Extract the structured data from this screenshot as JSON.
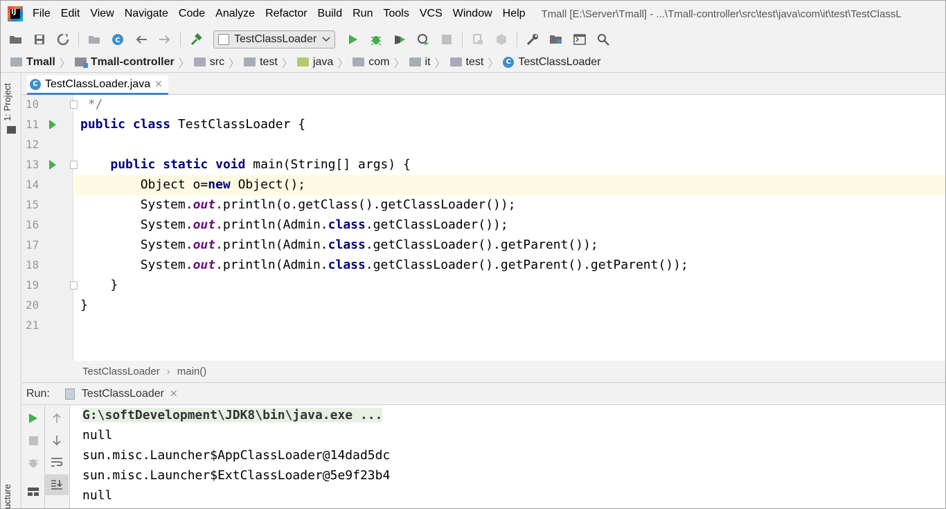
{
  "menu": {
    "items": [
      "File",
      "Edit",
      "View",
      "Navigate",
      "Code",
      "Analyze",
      "Refactor",
      "Build",
      "Run",
      "Tools",
      "VCS",
      "Window",
      "Help"
    ],
    "window_title": "Tmall [E:\\Server\\Tmall] - ...\\Tmall-controller\\src\\test\\java\\com\\it\\test\\TestClassL"
  },
  "toolbar": {
    "run_config": "TestClassLoader",
    "icons": [
      "open-folder-icon",
      "save-icon",
      "sync-icon",
      "project-structure-icon",
      "class-icon",
      "back-icon",
      "forward-icon",
      "build-hammer-icon",
      "run-icon",
      "debug-icon",
      "coverage-icon",
      "profile-icon",
      "stop-icon",
      "attach-icon",
      "deploy-icon",
      "settings-wrench-icon",
      "project-settings-icon",
      "terminal-icon",
      "search-icon"
    ]
  },
  "breadcrumbs": [
    "Tmall",
    "Tmall-controller",
    "src",
    "test",
    "java",
    "com",
    "it",
    "test",
    "TestClassLoader"
  ],
  "left_strip": {
    "project_tab": "1: Project",
    "structure_tab": "ucture"
  },
  "editor": {
    "tab_label": "TestClassLoader.java",
    "class_badge": "C",
    "current_line": 14,
    "lines": [
      {
        "num": "10",
        "code": " */",
        "run": false,
        "fold": true
      },
      {
        "num": "11",
        "code": "public class TestClassLoader {",
        "run": true,
        "fold": false
      },
      {
        "num": "12",
        "code": "",
        "run": false,
        "fold": false
      },
      {
        "num": "13",
        "code": "    public static void main(String[] args) {",
        "run": true,
        "fold": true
      },
      {
        "num": "14",
        "code": "        Object o=new Object();",
        "run": false,
        "fold": false
      },
      {
        "num": "15",
        "code": "        System.out.println(o.getClass().getClassLoader());",
        "run": false,
        "fold": false
      },
      {
        "num": "16",
        "code": "        System.out.println(Admin.class.getClassLoader());",
        "run": false,
        "fold": false
      },
      {
        "num": "17",
        "code": "        System.out.println(Admin.class.getClassLoader().getParent());",
        "run": false,
        "fold": false
      },
      {
        "num": "18",
        "code": "        System.out.println(Admin.class.getClassLoader().getParent().getParent());",
        "run": false,
        "fold": false
      },
      {
        "num": "19",
        "code": "    }",
        "run": false,
        "fold": true
      },
      {
        "num": "20",
        "code": "}",
        "run": false,
        "fold": false
      },
      {
        "num": "21",
        "code": "",
        "run": false,
        "fold": false
      }
    ],
    "crumbs": [
      "TestClassLoader",
      "main()"
    ]
  },
  "run": {
    "label": "Run:",
    "tab_label": "TestClassLoader",
    "output": [
      "G:\\softDevelopment\\JDK8\\bin\\java.exe ...",
      "null",
      "sun.misc.Launcher$AppClassLoader@14dad5dc",
      "sun.misc.Launcher$ExtClassLoader@5e9f23b4",
      "null"
    ]
  },
  "colors": {
    "keyword": "#000080",
    "static_field": "#660e7a",
    "run_green": "#3fb04a",
    "current_line": "#fffae3",
    "tab_underline": "#4083c9"
  }
}
